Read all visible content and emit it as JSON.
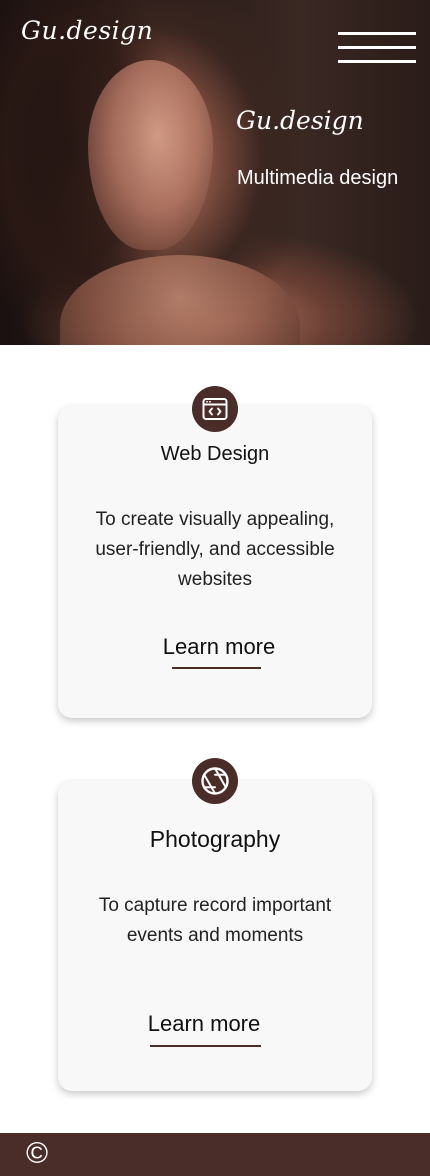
{
  "header": {
    "logo": "Gu.design"
  },
  "hero": {
    "title": "Gu.design",
    "subtitle": "Multimedia design",
    "image_icon": "portrait-photo"
  },
  "cards": [
    {
      "icon": "browser-code-icon",
      "title": "Web Design",
      "description": "To create visually appealing, user-friendly, and accessible websites",
      "link_label": "Learn more"
    },
    {
      "icon": "camera-aperture-icon",
      "title": "Photography",
      "description": "To capture record important events and moments",
      "link_label": "Learn more"
    }
  ],
  "footer": {
    "symbol": "©"
  },
  "colors": {
    "accent": "#4a2c28",
    "card_bg": "#f8f8f8",
    "text": "#111111"
  }
}
